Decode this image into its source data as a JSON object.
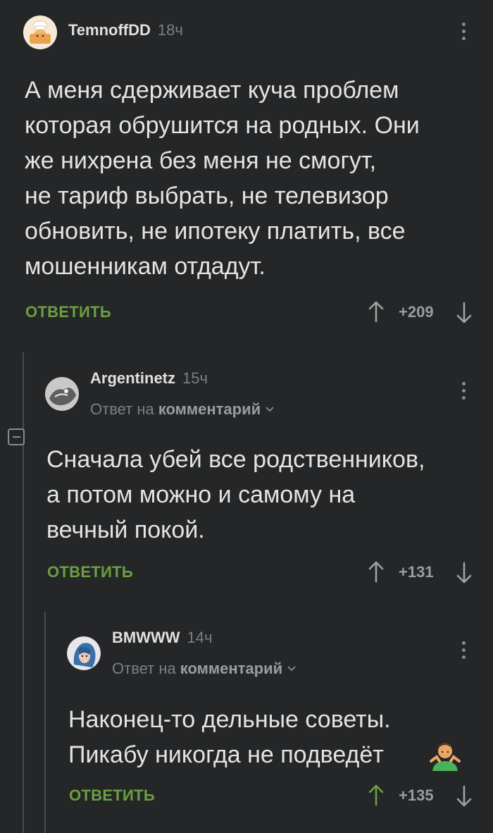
{
  "comments": [
    {
      "username": "TemnoffDD",
      "time": "18ч",
      "text": "А меня сдерживает куча проблем\nкоторая обрушится на родных. Они\nже нихрена без меня не смогут,\nне тариф выбрать, не телевизор\nобновить, не ипотеку платить, все\nмошенникам отдадут.",
      "reply_label": "ОТВЕТИТЬ",
      "rating": "+209"
    },
    {
      "username": "Argentinetz",
      "time": "15ч",
      "reply_to_prefix": "Ответ на",
      "reply_to_target": "комментарий",
      "text": "Сначала убей все родственников,\nа потом можно и самому на\nвечный покой.",
      "reply_label": "ОТВЕТИТЬ",
      "rating": "+131"
    },
    {
      "username": "BMWWW",
      "time": "14ч",
      "reply_to_prefix": "Ответ на",
      "reply_to_target": "комментарий",
      "text": "Наконец-то дельные советы.\nПикабу никогда не подведёт",
      "reply_label": "ОТВЕТИТЬ",
      "rating": "+135"
    }
  ],
  "colors": {
    "background": "#252627",
    "reply_green": "#6aa041",
    "upvote_active": "#6aa041",
    "muted": "#7d7f81"
  },
  "icons": [
    "chef-avatar",
    "kebab-menu-icon",
    "arrow-up-icon",
    "arrow-down-icon",
    "collapse-icon",
    "chevron-down-icon",
    "shrug-emoji"
  ]
}
